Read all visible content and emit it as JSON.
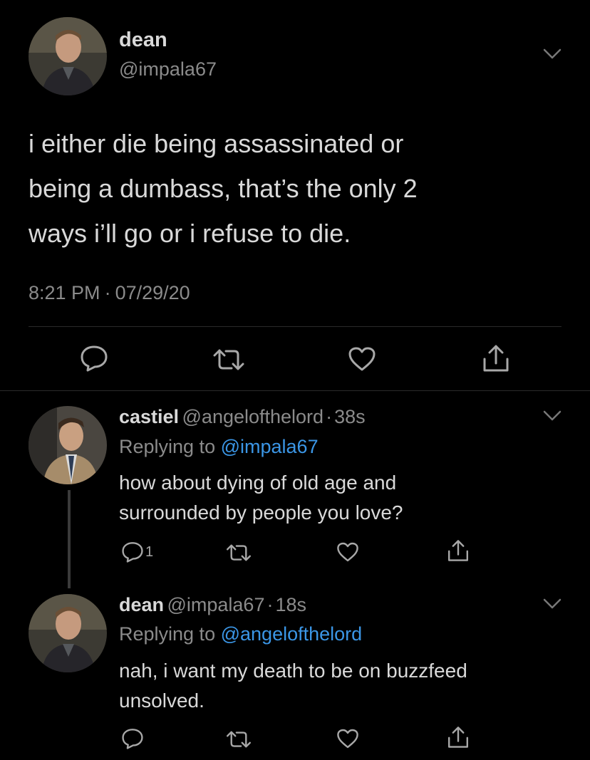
{
  "main_tweet": {
    "display_name": "dean",
    "handle": "@impala67",
    "text": "i either die being assassinated or\nbeing a dumbass, that’s the only 2\nways i’ll go or i refuse to die.",
    "time": "8:21 PM",
    "separator": "·",
    "date": "07/29/20"
  },
  "replies": [
    {
      "display_name": "castiel",
      "handle": "@angelofthelord",
      "separator": "·",
      "age": "38s",
      "replying_prefix": "Replying to",
      "replying_to": "@impala67",
      "text": "how about dying of old age and surrounded by people you love?",
      "reply_count": "1"
    },
    {
      "display_name": "dean",
      "handle": "@impala67",
      "separator": "·",
      "age": "18s",
      "replying_prefix": "Replying to",
      "replying_to": "@angelofthelord",
      "text": "nah, i want my death to be on buzzfeed unsolved."
    }
  ],
  "icons": [
    "reply-icon",
    "retweet-icon",
    "like-icon",
    "share-icon",
    "chevron-down-icon"
  ],
  "colors": {
    "background": "#000000",
    "text": "#d9d9d9",
    "muted": "#8b8b8b",
    "link": "#3b96e6"
  }
}
